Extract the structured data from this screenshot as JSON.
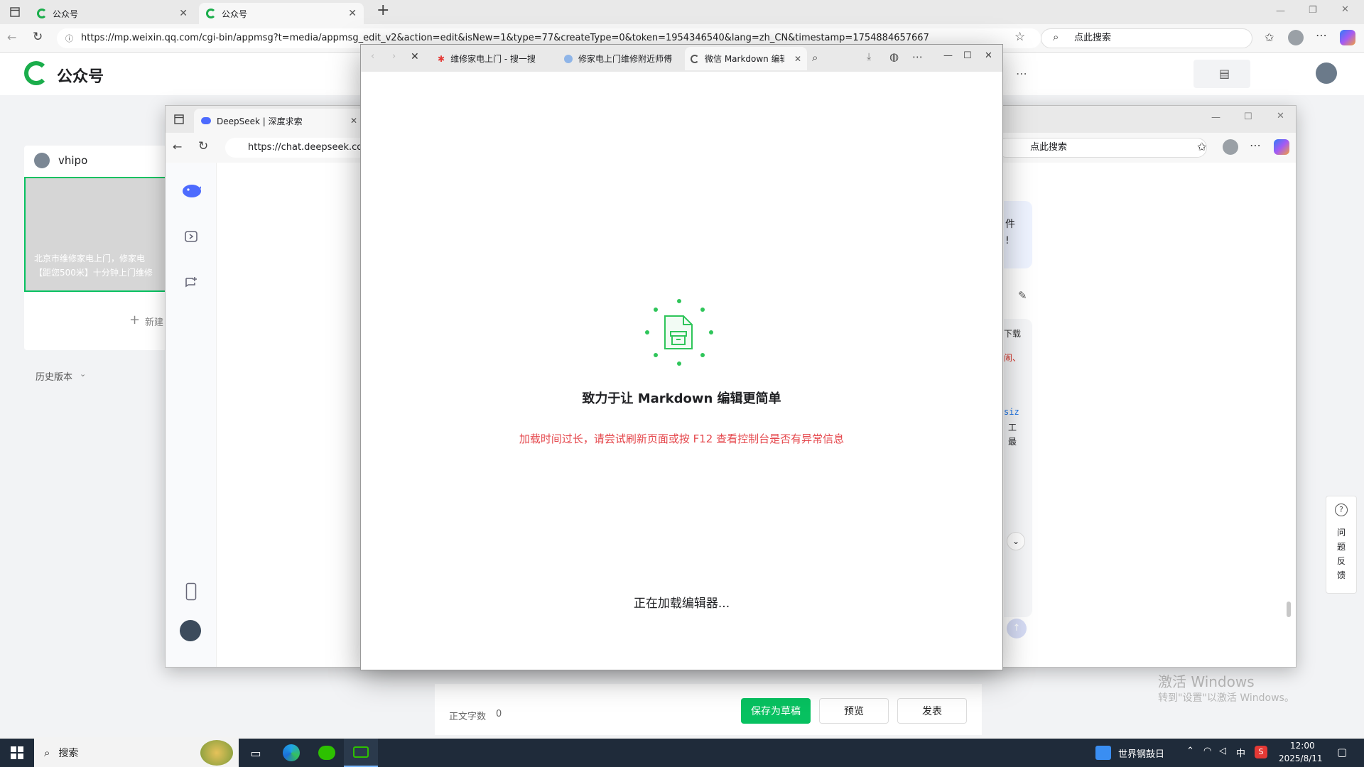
{
  "browser": {
    "tabs": [
      {
        "label": "公众号"
      },
      {
        "label": "公众号"
      }
    ],
    "new_tab": "+",
    "url": "https://mp.weixin.qq.com/cgi-bin/appmsg?t=media/appmsg_edit_v2&action=edit&isNew=1&type=77&createType=0&token=1954346540&lang=zh_CN&timestamp=1754884657667",
    "search_placeholder": "点此搜索"
  },
  "mp": {
    "logo_text": "公众号",
    "account_name": "vhipo",
    "article_title_line1": "北京市维修家电上门，修家电",
    "article_title_line2": "【距您500米】十分钟上门维修",
    "new_label": "新建",
    "history_label": "历史版本",
    "word_count_label": "正文字数",
    "word_count_value": "0",
    "save_draft": "保存为草稿",
    "preview": "预览",
    "publish": "发表",
    "feedback": [
      "问",
      "题",
      "反",
      "馈"
    ]
  },
  "deepseek": {
    "tab_label": "DeepSeek | 深度求索",
    "url": "https://chat.deepseek.com",
    "search_placeholder": "点此搜索",
    "right_snippets": [
      "件",
      "!",
      "下载",
      "闹、",
      "siz",
      "工",
      "最"
    ]
  },
  "popup": {
    "tabs": [
      {
        "label": "维修家电上门 - 搜一搜"
      },
      {
        "label": "修家电上门维修附近师傅"
      },
      {
        "label": "微信 Markdown 编辑器"
      }
    ],
    "headline": "致力于让 Markdown 编辑更简单",
    "error": "加载时间过长，请尝试刷新页面或按 F12 查看控制台是否有异常信息",
    "loading": "正在加载编辑器..."
  },
  "watermark": {
    "line1": "激活 Windows",
    "line2": "转到\"设置\"以激活 Windows。"
  },
  "taskbar": {
    "search": "搜索",
    "weather": "世界钢鼓日",
    "ime": "中",
    "time": "12:00",
    "date": "2025/8/11"
  },
  "colors": {
    "brand_green": "#07c160",
    "error_red": "#e5484d",
    "taskbar": "#1f2b3a"
  }
}
